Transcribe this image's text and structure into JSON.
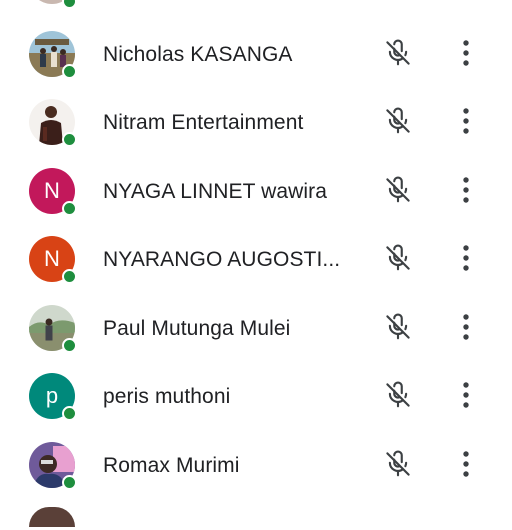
{
  "colors": {
    "status_online": "#1e8e3e",
    "text": "#202124",
    "icon": "#3c4043"
  },
  "participants": [
    {
      "name": "Nicholas KASANGA",
      "avatar_type": "photo",
      "mic": "mic-off-icon"
    },
    {
      "name": "Nitram Entertainment",
      "avatar_type": "photo",
      "mic": "mic-off-icon"
    },
    {
      "name": "NYAGA LINNET wawira",
      "avatar_type": "initial",
      "initial": "N",
      "avatar_color": "#c2185b",
      "mic": "mic-off-icon"
    },
    {
      "name": "NYARANGO AUGOSTI...",
      "avatar_type": "initial",
      "initial": "N",
      "avatar_color": "#d84315",
      "mic": "mic-off-icon"
    },
    {
      "name": "Paul Mutunga Mulei",
      "avatar_type": "photo",
      "mic": "mic-off-icon"
    },
    {
      "name": "peris muthoni",
      "avatar_type": "initial",
      "initial": "p",
      "avatar_color": "#00897b",
      "mic": "mic-off-icon"
    },
    {
      "name": "Romax Murimi",
      "avatar_type": "photo",
      "mic": "mic-off-icon"
    }
  ]
}
